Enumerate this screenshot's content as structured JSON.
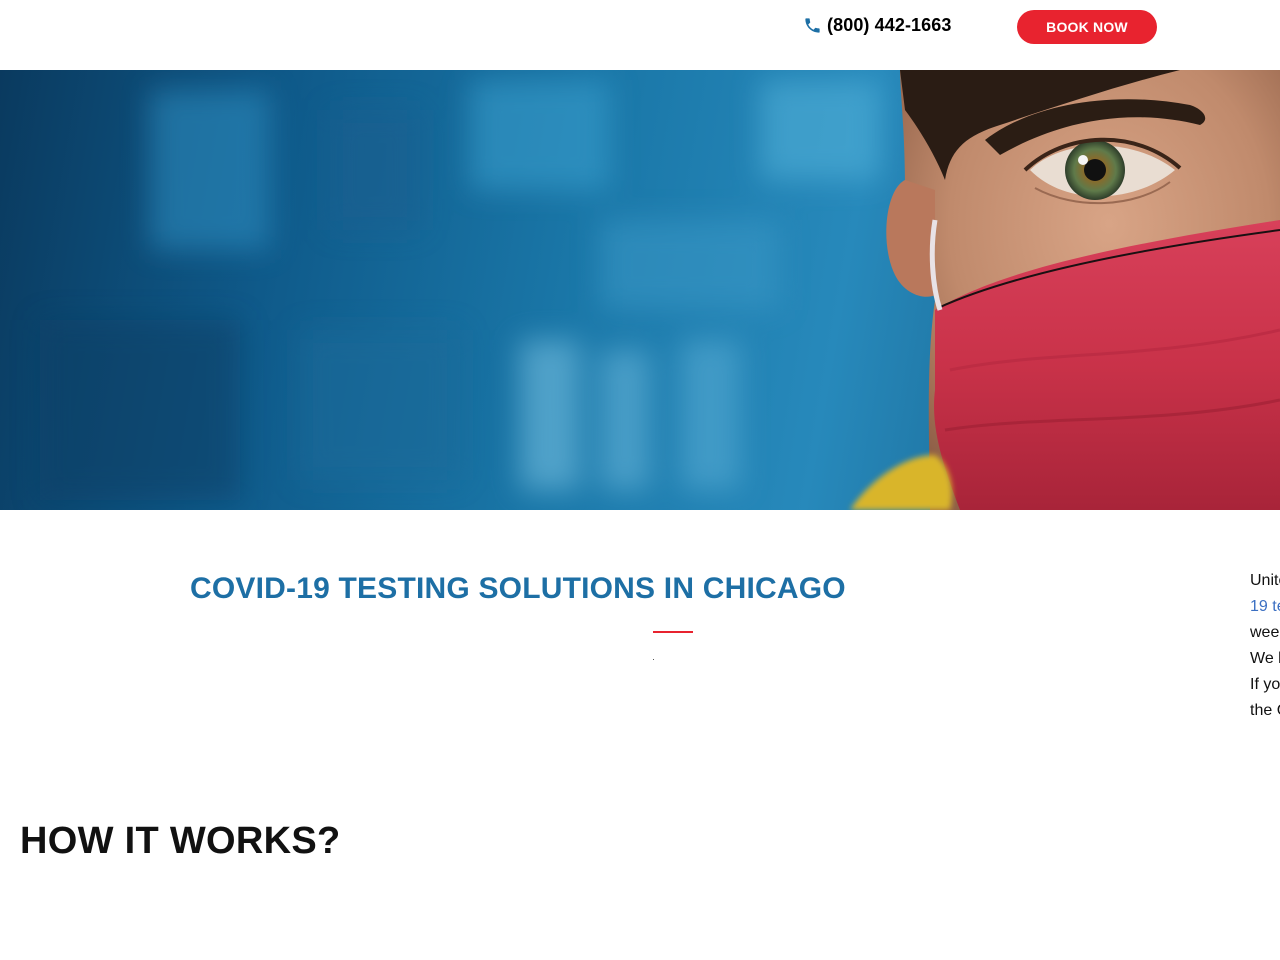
{
  "header": {
    "phone_icon": "phone-icon",
    "phone_number": "(800) 442-1663",
    "book_label": "BOOK NOW",
    "accent_color": "#e8232f",
    "phone_icon_color": "#1d6fa5"
  },
  "hero": {
    "image": "person-with-red-face-mask-on-blue-background"
  },
  "main": {
    "title": "COVID-19 TESTING SOLUTIONS IN CHICAGO",
    "title_color": "#1d6fa5",
    "side_text_lines": [
      {
        "text": "Unite",
        "link": false
      },
      {
        "text": "19 te",
        "link": true
      },
      {
        "text": "wee",
        "link": false
      },
      {
        "text": "We l",
        "link": false
      },
      {
        "text": "If yo",
        "link": false
      },
      {
        "text": "the C",
        "link": false
      }
    ],
    "link_color": "#3b6fc2"
  },
  "how_it_works": {
    "title": "HOW IT WORKS?"
  }
}
